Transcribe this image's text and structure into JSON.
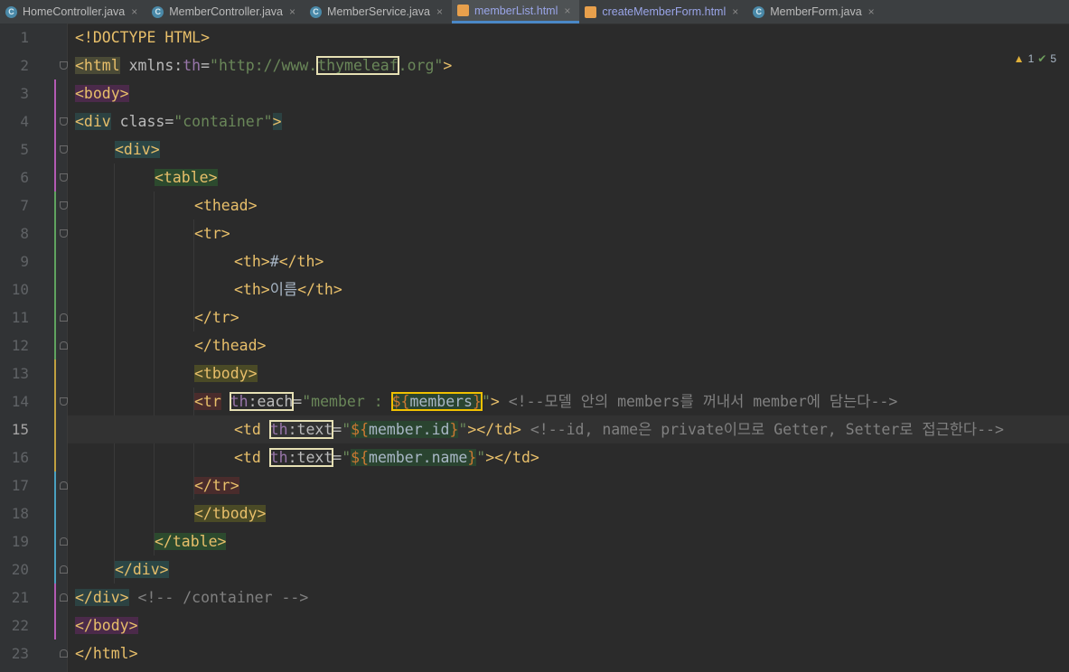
{
  "tabs": [
    {
      "label": "HomeController.java",
      "type": "java",
      "active": false
    },
    {
      "label": "MemberController.java",
      "type": "java",
      "active": false
    },
    {
      "label": "MemberService.java",
      "type": "java",
      "active": false
    },
    {
      "label": "memberList.html",
      "type": "html",
      "active": true
    },
    {
      "label": "createMemberForm.html",
      "type": "html",
      "active": false
    },
    {
      "label": "MemberForm.java",
      "type": "java",
      "active": false
    }
  ],
  "tab_close_glyph": "×",
  "inspection": {
    "warnings": "1",
    "weak_warnings": "5"
  },
  "line_numbers": [
    "1",
    "2",
    "3",
    "4",
    "5",
    "6",
    "7",
    "8",
    "9",
    "10",
    "11",
    "12",
    "13",
    "14",
    "15",
    "16",
    "17",
    "18",
    "19",
    "20",
    "21",
    "22",
    "23"
  ],
  "current_line": "15",
  "code": {
    "l1": "<!DOCTYPE HTML>",
    "l2_open": "<html",
    "l2_attr": " xmlns:",
    "l2_th": "th",
    "l2_eq": "=",
    "l2_str1": "\"http://www.",
    "l2_box": "thymeleaf",
    "l2_str2": ".org\"",
    "l2_close": ">",
    "l3": "<body>",
    "l4_open": "<div",
    "l4_attr": " class=",
    "l4_str": "\"container\"",
    "l4_close": ">",
    "l5": "<div>",
    "l6": "<table>",
    "l7": "<thead>",
    "l8": "<tr>",
    "l9_open": "<th>",
    "l9_text": "#",
    "l9_close": "</th>",
    "l10_open": "<th>",
    "l10_text": "이름",
    "l10_close": "</th>",
    "l11": "</tr>",
    "l12": "</thead>",
    "l13": "<tbody>",
    "l14_open": "<tr",
    "l14_th": "th",
    "l14_attr": ":each",
    "l14_eq": "=",
    "l14_str1": "\"member : ",
    "l14_expr": "${",
    "l14_var": "members",
    "l14_exprc": "}",
    "l14_str2": "\"",
    "l14_close": ">",
    "l14_comment": " <!--모델 안의 members를 꺼내서 member에 담는다-->",
    "l15_open": "<td",
    "l15_th": "th",
    "l15_attr": ":text",
    "l15_eq": "=",
    "l15_str1": "\"",
    "l15_expr": "${",
    "l15_var": "member.id",
    "l15_exprc": "}",
    "l15_str2": "\"",
    "l15_close": "></td>",
    "l15_comment": " <!--id, name은 private이므로 Getter, Setter로 접근한다-->",
    "l16_open": "<td",
    "l16_th": "th",
    "l16_attr": ":text",
    "l16_eq": "=",
    "l16_str1": "\"",
    "l16_expr": "${",
    "l16_var": "member.name",
    "l16_exprc": "}",
    "l16_str2": "\"",
    "l16_close": "></td>",
    "l17": "</tr>",
    "l18": "</tbody>",
    "l19": "</table>",
    "l20": "</div>",
    "l21_tag": "</div>",
    "l21_comment": " <!-- /container -->",
    "l22": "</body>",
    "l23": "</html>"
  },
  "colors": {
    "background": "#2b2b2b",
    "tag": "#e8bf6a",
    "string": "#6a8759",
    "thymeleaf_namespace": "#9876aa",
    "comment": "#808080",
    "highlight_box": "#e6e0b4",
    "highlight_box_yellow": "#f0c000"
  }
}
